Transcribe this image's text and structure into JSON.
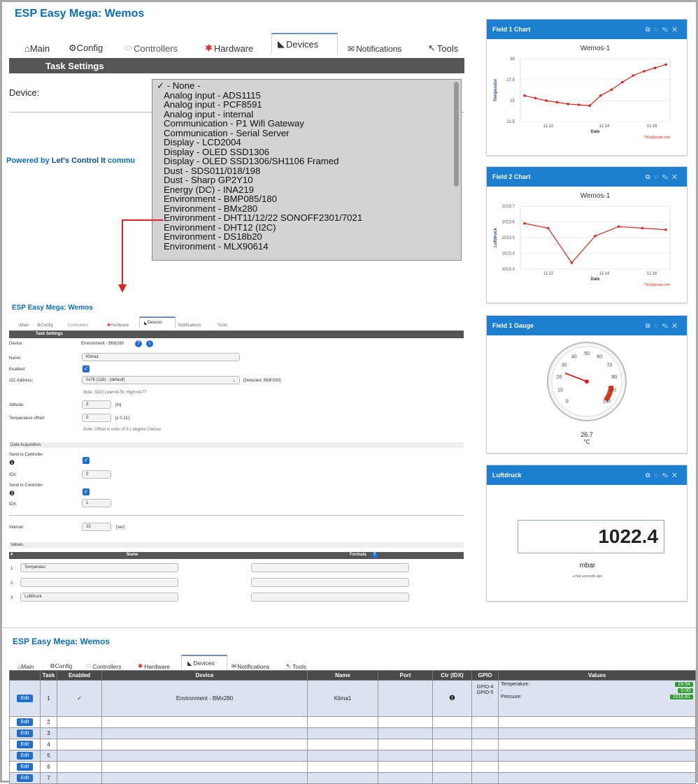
{
  "top": {
    "title": "ESP Easy Mega: Wemos",
    "tabs": [
      "⌂Main",
      "⚙Config",
      "Controllers",
      "Hardware",
      "Devices",
      "Notifications",
      "Tools"
    ],
    "section": "Task Settings",
    "device_label": "Device:",
    "powered_prefix": "Powered by ",
    "powered_brand": "Let's Control It",
    "powered_suffix": " commu",
    "dropdown": [
      "✓ - None -",
      "Analog input - ADS1115",
      "Analog input - PCF8591",
      "Analog input - internal",
      "Communication - P1 Wifi Gateway",
      "Communication - Serial Server",
      "Display - LCD2004",
      "Display - OLED SSD1306",
      "Display - OLED SSD1306/SH1106 Framed",
      "Dust - SDS011/018/198",
      "Dust - Sharp GP2Y10",
      "Energy (DC) - INA219",
      "Environment - BMP085/180",
      "Environment - BMx280",
      "Environment - DHT11/12/22 SONOFF2301/7021",
      "Environment - DHT12 (I2C)",
      "Environment - DS18b20",
      "Environment - MLX90614"
    ]
  },
  "mid": {
    "title": "ESP Easy Mega: Wemos",
    "tabs": [
      "⌂Main",
      "⚙Config",
      "Controllers",
      "Hardware",
      "Devices",
      "Notifications",
      "Tools"
    ],
    "section": "Task Settings",
    "device_label": "Device:",
    "device_value": "Environment - BMx280",
    "name_label": "Name:",
    "name_value": "Klima1",
    "enabled_label": "Enabled:",
    "i2c_label": "I2C Address:",
    "i2c_value": "0x76 (118) - (default)",
    "i2c_detected": "[Detected: BMP280]",
    "i2c_note": "Note: SDO Low=0x76, High=0x77",
    "altitude_label": "Altitude:",
    "altitude_value": "3",
    "altitude_unit": "[m]",
    "temp_off_label": "Temperature offset:",
    "temp_off_value": "0",
    "temp_off_unit": "[x 0.1C]",
    "temp_off_note": "Note: Offset in units of 0.1 degree Celcius",
    "data_acq": "Data Acquisition",
    "send1": "Send to Controller",
    "idx_label": "IDX:",
    "idx1": "0",
    "send2": "Send to Controller",
    "idx2": "1",
    "interval_label": "Interval:",
    "interval_value": "15",
    "interval_unit": "[sec]",
    "values_label": "Values",
    "col_hash": "#",
    "col_name": "Name",
    "col_formula": "Formula",
    "values": [
      {
        "n": "1",
        "name": "Temperatur"
      },
      {
        "n": "2",
        "name": ""
      },
      {
        "n": "3",
        "name": "Luftdruck"
      }
    ]
  },
  "bottom": {
    "title": "ESP Easy Mega: Wemos",
    "tabs": [
      "⌂Main",
      "⚙Config",
      "Controllers",
      "Hardware",
      "Devices",
      "Notifications",
      "Tools"
    ],
    "headers": [
      "",
      "Task",
      "Enabled",
      "Device",
      "Name",
      "Port",
      "Ctr (IDX)",
      "GPIO",
      "Values"
    ],
    "edit_label": "Edit",
    "row1": {
      "task": "1",
      "enabled": "✔",
      "device": "Environment - BMx280",
      "name": "Klima1",
      "ctr": "❶",
      "gpio1": "GPIO-4",
      "gpio2": "GPIO-5",
      "v1_label": "Temperature:",
      "v1": "24.54",
      "v2_label": "-",
      "v2": "0.00",
      "v3_label": "Pressure:",
      "v3": "1016.81"
    },
    "other_tasks": [
      "2",
      "3",
      "4",
      "5",
      "6",
      "7"
    ]
  },
  "field1": {
    "title": "Field 1 Chart",
    "chart_title": "Wemos-1",
    "ylabel": "Temperatur",
    "xlabel": "Date",
    "credit": "ThingSpeak.com",
    "yticks": [
      "30",
      "27.5",
      "25",
      "22.5"
    ],
    "xticks": [
      "11:12",
      "11:14",
      "11:16"
    ]
  },
  "field2": {
    "title": "Field 2 Chart",
    "chart_title": "Wemos-1",
    "ylabel": "Luftdruck",
    "xlabel": "Date",
    "credit": "ThingSpeak.com",
    "yticks": [
      "1023.7",
      "1023.6",
      "1023.5",
      "1023.4",
      "1023.3"
    ],
    "xticks": [
      "11:12",
      "11:14",
      "11:16"
    ]
  },
  "gauge": {
    "title": "Field 1 Gauge",
    "value": "26.7",
    "unit": "°C",
    "ticks": [
      "0",
      "10",
      "20",
      "30",
      "40",
      "50",
      "60",
      "70",
      "80",
      "90",
      "100"
    ]
  },
  "luftdruck": {
    "title": "Luftdruck",
    "value": "1022.4",
    "unit": "mbar",
    "time": "a few seconds ago"
  },
  "panel_icons": [
    "external-link-icon",
    "comment-icon",
    "pencil-icon",
    "close-icon"
  ],
  "colors": {
    "accent": "#1c7fd0",
    "title_blue": "#0a6ebd",
    "line_red": "#d9261c",
    "header_dark": "#555555",
    "badge_green": "#2e9c2e"
  },
  "chart_data": [
    {
      "type": "line",
      "title": "Wemos-1",
      "xlabel": "Date",
      "ylabel": "Temperatur",
      "ylim": [
        22.5,
        30
      ],
      "x": [
        "11:11",
        "11:11.5",
        "11:12",
        "11:12.5",
        "11:13",
        "11:13.5",
        "11:14",
        "11:14.2",
        "11:14.5",
        "11:15",
        "11:15.5",
        "11:16",
        "11:16.5",
        "11:17"
      ],
      "values": [
        25.6,
        25.3,
        25.0,
        24.8,
        24.6,
        24.5,
        24.4,
        25.6,
        26.3,
        27.2,
        28.0,
        28.5,
        28.9,
        29.3
      ]
    },
    {
      "type": "line",
      "title": "Wemos-1",
      "xlabel": "Date",
      "ylabel": "Luftdruck",
      "ylim": [
        1023.3,
        1023.7
      ],
      "x": [
        "11:11",
        "11:12",
        "11:13",
        "11:14",
        "11:15",
        "11:16",
        "11:17"
      ],
      "values": [
        1023.59,
        1023.56,
        1023.34,
        1023.51,
        1023.57,
        1023.56,
        1023.55
      ]
    }
  ]
}
